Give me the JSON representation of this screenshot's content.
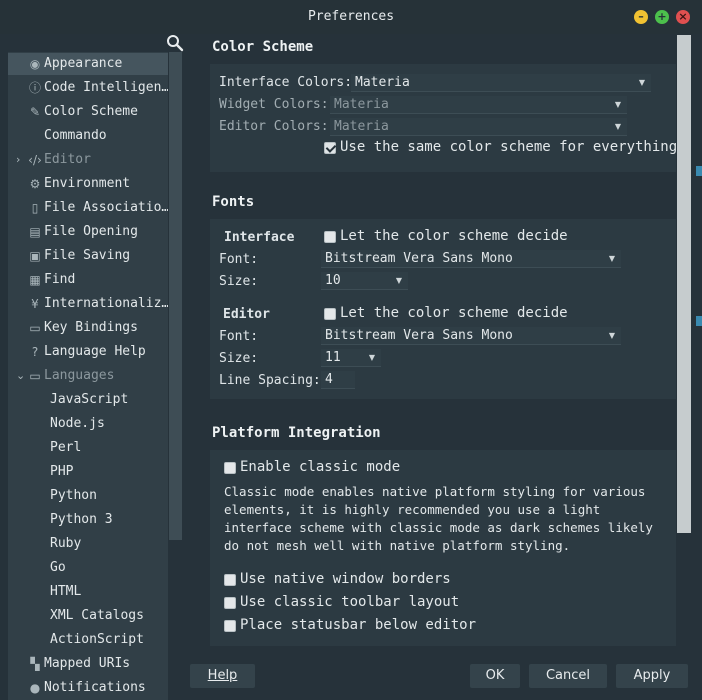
{
  "window": {
    "title": "Preferences",
    "controls": {
      "minimize": "–",
      "maximize": "+",
      "close": "×"
    }
  },
  "sidebar": {
    "items": [
      {
        "label": "Appearance",
        "icon": "eye-icon"
      },
      {
        "label": "Code Intelligen…",
        "icon": "info-icon"
      },
      {
        "label": "Color Scheme",
        "icon": "brush-icon"
      },
      {
        "label": "Commando",
        "icon": "none"
      },
      {
        "label": "Editor",
        "icon": "code-icon",
        "arrow": "›"
      },
      {
        "label": "Environment",
        "icon": "gear-icon"
      },
      {
        "label": "File Associatio…",
        "icon": "file-icon"
      },
      {
        "label": "File Opening",
        "icon": "file-open-icon"
      },
      {
        "label": "File Saving",
        "icon": "save-icon"
      },
      {
        "label": "Find",
        "icon": "find-icon"
      },
      {
        "label": "Internationaliz…",
        "icon": "yen-icon"
      },
      {
        "label": "Key Bindings",
        "icon": "keyboard-icon"
      },
      {
        "label": "Language Help",
        "icon": "help-icon"
      },
      {
        "label": "Languages",
        "icon": "folder-icon",
        "arrow": "⌄"
      },
      {
        "label": "JavaScript"
      },
      {
        "label": "Node.js"
      },
      {
        "label": "Perl"
      },
      {
        "label": "PHP"
      },
      {
        "label": "Python"
      },
      {
        "label": "Python 3"
      },
      {
        "label": "Ruby"
      },
      {
        "label": "Go"
      },
      {
        "label": "HTML"
      },
      {
        "label": "XML Catalogs"
      },
      {
        "label": "ActionScript"
      },
      {
        "label": "Mapped URIs",
        "icon": "map-icon"
      },
      {
        "label": "Notifications",
        "icon": "bell-icon"
      }
    ]
  },
  "color_scheme": {
    "title": "Color Scheme",
    "interface_label": "Interface Colors:",
    "interface_value": "Materia",
    "widget_label": "Widget Colors:",
    "widget_value": "Materia",
    "editor_label": "Editor Colors:",
    "editor_value": "Materia",
    "same_scheme_label": "Use the same color scheme for everything",
    "same_scheme_checked": true
  },
  "fonts": {
    "title": "Fonts",
    "interface": {
      "heading": "Interface",
      "let_scheme_label": "Let the color scheme decide",
      "font_label": "Font:",
      "font_value": "Bitstream Vera Sans Mono",
      "size_label": "Size:",
      "size_value": "10"
    },
    "editor": {
      "heading": "Editor",
      "let_scheme_label": "Let the color scheme decide",
      "font_label": "Font:",
      "font_value": "Bitstream Vera Sans Mono",
      "size_label": "Size:",
      "size_value": "11",
      "line_spacing_label": "Line Spacing:",
      "line_spacing_value": "4"
    }
  },
  "platform": {
    "title": "Platform Integration",
    "classic_mode_label": "Enable classic mode",
    "description": "Classic mode enables native platform styling for various elements, it is highly recommended you use a light interface scheme with classic mode as dark schemes likely do not mesh well with native platform styling.",
    "native_borders_label": "Use native window borders",
    "classic_toolbar_label": "Use classic toolbar layout",
    "statusbar_label": "Place statusbar below editor"
  },
  "footer": {
    "help_label": "Help",
    "ok_label": "OK",
    "cancel_label": "Cancel",
    "apply_label": "Apply"
  },
  "colors": {
    "background": "#26323a",
    "panel": "#2c3a42",
    "sidebar": "#313f47",
    "selected": "#45555e"
  }
}
